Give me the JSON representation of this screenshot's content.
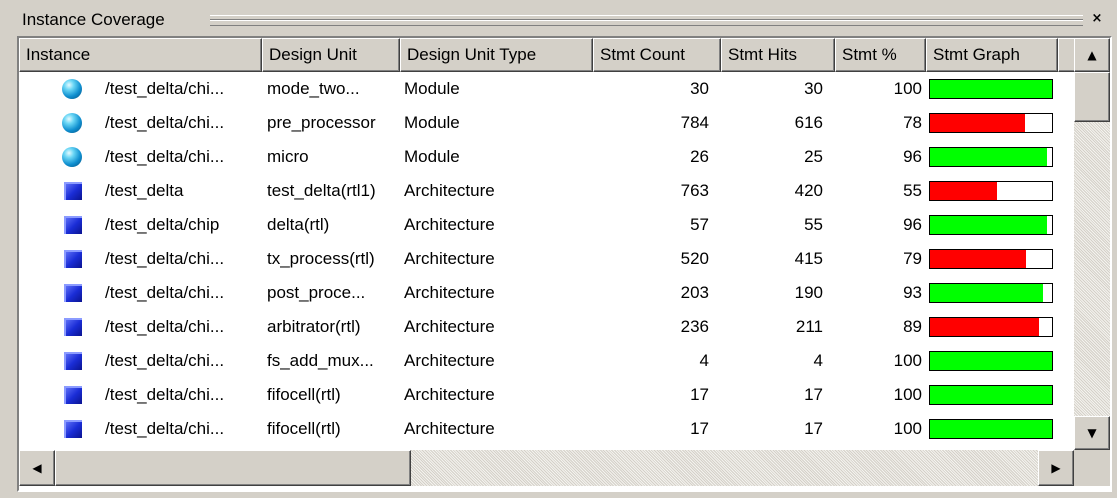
{
  "panel": {
    "title": "Instance Coverage",
    "close_glyph": "×"
  },
  "columns": [
    "Instance",
    "Design Unit",
    "Design Unit Type",
    "Stmt Count",
    "Stmt Hits",
    "Stmt %",
    "Stmt Graph"
  ],
  "colors": {
    "bar_good": "#00ff00",
    "bar_bad": "#ff0000"
  },
  "rows": [
    {
      "icon": "module-icon",
      "instance": "/test_delta/chi...",
      "design_unit": "mode_two...",
      "type": "Module",
      "count": "30",
      "hits": "30",
      "pct": "100",
      "graph_fraction": 1.0,
      "status": "good"
    },
    {
      "icon": "module-icon",
      "instance": "/test_delta/chi...",
      "design_unit": "pre_processor",
      "type": "Module",
      "count": "784",
      "hits": "616",
      "pct": "78",
      "graph_fraction": 0.78,
      "status": "bad"
    },
    {
      "icon": "module-icon",
      "instance": "/test_delta/chi...",
      "design_unit": "micro",
      "type": "Module",
      "count": "26",
      "hits": "25",
      "pct": "96",
      "graph_fraction": 0.96,
      "status": "good"
    },
    {
      "icon": "architecture-icon",
      "instance": "/test_delta",
      "design_unit": "test_delta(rtl1)",
      "type": "Architecture",
      "count": "763",
      "hits": "420",
      "pct": "55",
      "graph_fraction": 0.55,
      "status": "bad"
    },
    {
      "icon": "architecture-icon",
      "instance": "/test_delta/chip",
      "design_unit": "delta(rtl)",
      "type": "Architecture",
      "count": "57",
      "hits": "55",
      "pct": "96",
      "graph_fraction": 0.96,
      "status": "good"
    },
    {
      "icon": "architecture-icon",
      "instance": "/test_delta/chi...",
      "design_unit": "tx_process(rtl)",
      "type": "Architecture",
      "count": "520",
      "hits": "415",
      "pct": "79",
      "graph_fraction": 0.79,
      "status": "bad"
    },
    {
      "icon": "architecture-icon",
      "instance": "/test_delta/chi...",
      "design_unit": "post_proce...",
      "type": "Architecture",
      "count": "203",
      "hits": "190",
      "pct": "93",
      "graph_fraction": 0.93,
      "status": "good"
    },
    {
      "icon": "architecture-icon",
      "instance": "/test_delta/chi...",
      "design_unit": "arbitrator(rtl)",
      "type": "Architecture",
      "count": "236",
      "hits": "211",
      "pct": "89",
      "graph_fraction": 0.89,
      "status": "bad"
    },
    {
      "icon": "architecture-icon",
      "instance": "/test_delta/chi...",
      "design_unit": "fs_add_mux...",
      "type": "Architecture",
      "count": "4",
      "hits": "4",
      "pct": "100",
      "graph_fraction": 1.0,
      "status": "good"
    },
    {
      "icon": "architecture-icon",
      "instance": "/test_delta/chi...",
      "design_unit": "fifocell(rtl)",
      "type": "Architecture",
      "count": "17",
      "hits": "17",
      "pct": "100",
      "graph_fraction": 1.0,
      "status": "good"
    },
    {
      "icon": "architecture-icon",
      "instance": "/test_delta/chi...",
      "design_unit": "fifocell(rtl)",
      "type": "Architecture",
      "count": "17",
      "hits": "17",
      "pct": "100",
      "graph_fraction": 1.0,
      "status": "good"
    }
  ],
  "scroll_glyphs": {
    "up": "▲",
    "down": "▼",
    "left": "◀",
    "right": "▶"
  }
}
